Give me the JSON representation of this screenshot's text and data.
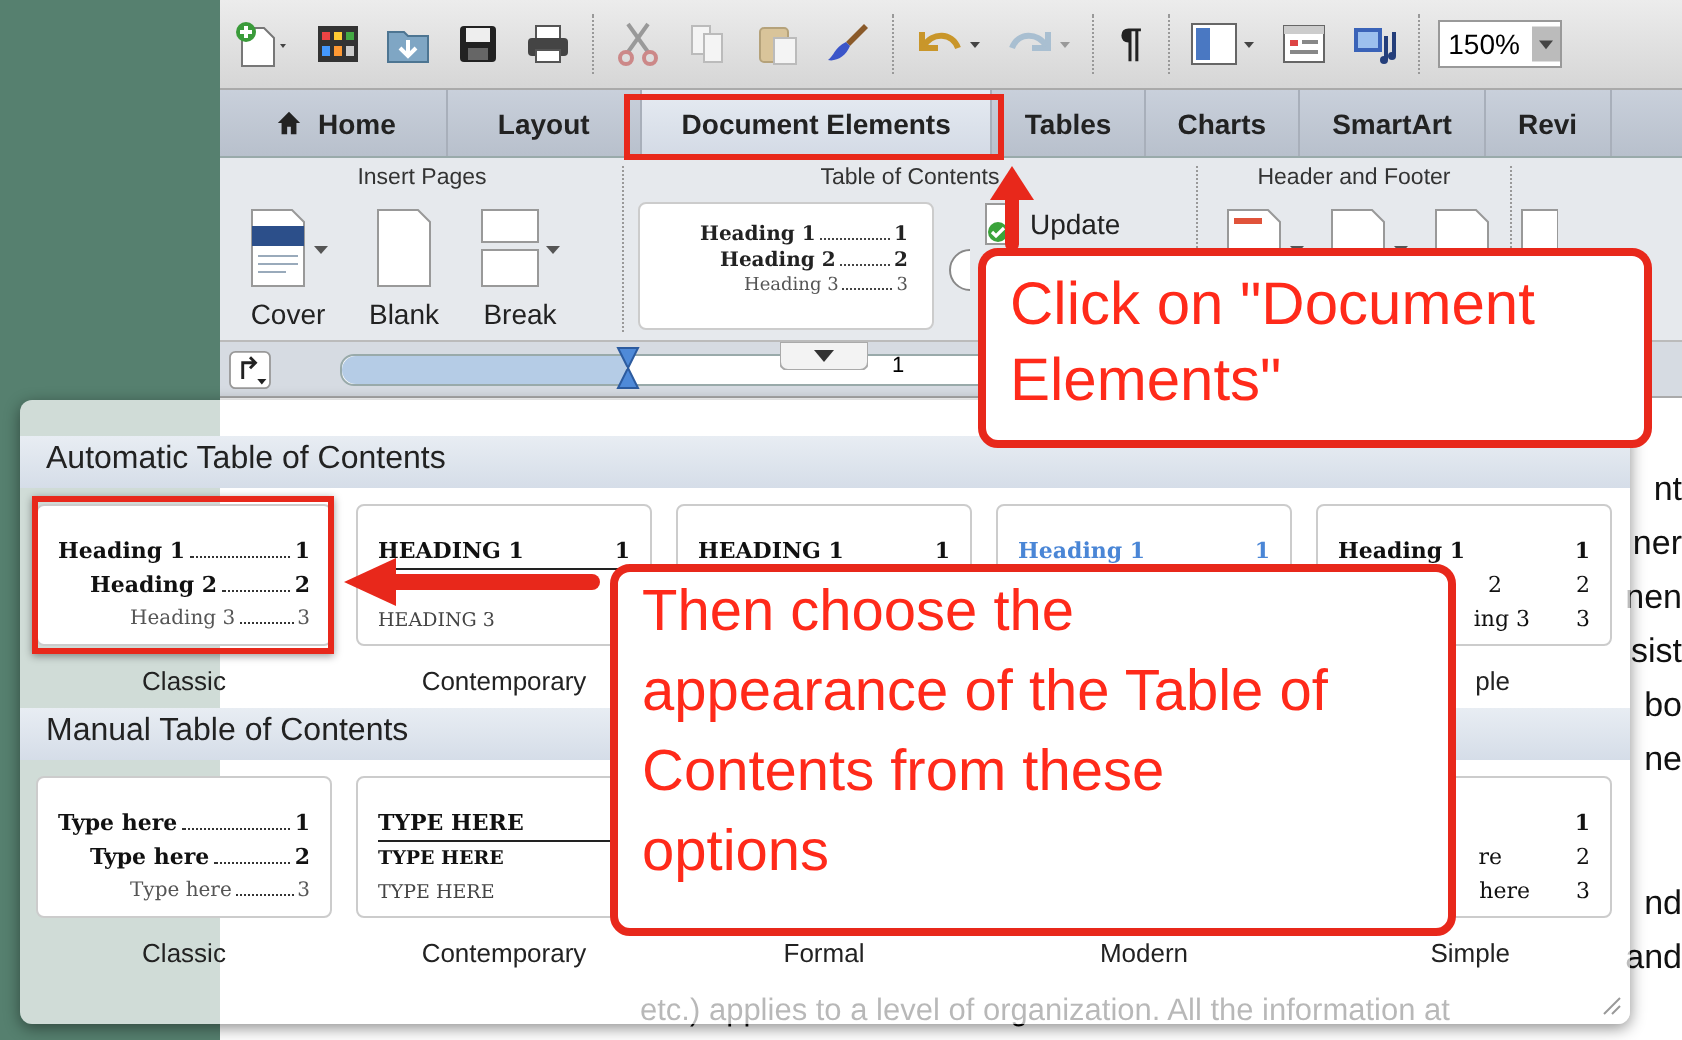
{
  "toolbar": {
    "pilcrow": "¶",
    "zoom": "150%"
  },
  "tabs": [
    {
      "label": "Home",
      "selected": false,
      "kind": "home"
    },
    {
      "label": "Layout",
      "selected": false,
      "kind": "plain"
    },
    {
      "label": "Document Elements",
      "selected": true,
      "kind": "plain"
    },
    {
      "label": "Tables",
      "selected": false,
      "kind": "plain"
    },
    {
      "label": "Charts",
      "selected": false,
      "kind": "plain"
    },
    {
      "label": "SmartArt",
      "selected": false,
      "kind": "plain"
    },
    {
      "label": "Revi",
      "selected": false,
      "kind": "plain"
    }
  ],
  "ribbon": {
    "insert_pages": {
      "title": "Insert Pages",
      "buttons": [
        {
          "label": "Cover",
          "kind": "cover"
        },
        {
          "label": "Blank",
          "kind": "blank"
        },
        {
          "label": "Break",
          "kind": "break"
        }
      ]
    },
    "toc": {
      "title": "Table of Contents",
      "update": "Update",
      "preview": [
        {
          "kind": "h1",
          "text": "Heading 1",
          "num": "1"
        },
        {
          "kind": "h2",
          "text": "Heading 2",
          "num": "2"
        },
        {
          "kind": "h3",
          "text": "Heading 3",
          "num": "3"
        }
      ]
    },
    "header_footer": {
      "title": "Header and Footer"
    }
  },
  "ruler": {
    "mark": "1"
  },
  "gallery": {
    "sections": [
      {
        "title": "Automatic Table of Contents",
        "items": [
          {
            "kind": "classic",
            "label": "Classic",
            "lines": [
              {
                "kind": "h1",
                "text": "Heading 1",
                "num": "1"
              },
              {
                "kind": "h2",
                "text": "Heading 2",
                "num": "2"
              },
              {
                "kind": "h3",
                "text": "Heading 3",
                "num": "3"
              }
            ]
          },
          {
            "kind": "contemporary",
            "label": "Contemporary",
            "lines": [
              {
                "kind": "h1",
                "text": "HEADING 1",
                "num": "1"
              },
              {
                "kind": "h3",
                "text": "HEADING 3"
              }
            ]
          },
          {
            "kind": "formal",
            "lines": [
              {
                "kind": "h1",
                "text": "HEADING 1",
                "num": "1"
              }
            ]
          },
          {
            "kind": "modern",
            "lines": [
              {
                "kind": "h1",
                "text": "Heading 1",
                "num": "1"
              }
            ]
          },
          {
            "kind": "simple",
            "label": "ple",
            "lines": [
              {
                "kind": "h1",
                "text": "Heading 1",
                "num": "1"
              },
              {
                "kind": "h2",
                "text": "2",
                "num": "2"
              },
              {
                "kind": "h3",
                "text": "ing 3",
                "num": "3"
              }
            ]
          }
        ]
      },
      {
        "title": "Manual Table of Contents",
        "items": [
          {
            "kind": "classic",
            "label": "Classic",
            "lines": [
              {
                "kind": "h1",
                "text": "Type here",
                "num": "1"
              },
              {
                "kind": "h2",
                "text": "Type here",
                "num": "2"
              },
              {
                "kind": "h3",
                "text": "Type here",
                "num": "3"
              }
            ]
          },
          {
            "kind": "contemporary",
            "label": "Contemporary",
            "lines": [
              {
                "kind": "h1",
                "text": "TYPE HERE"
              },
              {
                "kind": "h2",
                "text": "TYPE HERE"
              },
              {
                "kind": "h3",
                "text": "TYPE HERE"
              }
            ]
          },
          {
            "kind": "formal",
            "label": "Formal"
          },
          {
            "kind": "modern",
            "label": "Modern"
          },
          {
            "kind": "simple",
            "label": "Simple",
            "lines": [
              {
                "kind": "h1",
                "num": "1"
              },
              {
                "kind": "h2",
                "text": "re",
                "num": "2"
              },
              {
                "kind": "h3",
                "text": "here",
                "num": "3"
              }
            ]
          }
        ]
      }
    ]
  },
  "document": {
    "paragraphs": [
      {
        "lines": [
          {
            "kind": "tail",
            "text": "nt"
          },
          {
            "kind": "tail",
            "text": "ner"
          },
          {
            "kind": "tail",
            "text": "nen"
          },
          {
            "kind": "tail",
            "text": "sist"
          },
          {
            "kind": "tail",
            "text": "bo"
          },
          {
            "kind": "tail",
            "text": "ne"
          }
        ]
      },
      {
        "lines": [
          {
            "kind": "tail",
            "text": "nd"
          },
          {
            "kind": "tail",
            "text": "and"
          },
          {
            "kind": "full",
            "text": "etc.) applies to a level of organization. All the information at"
          }
        ]
      }
    ]
  },
  "callouts": [
    {
      "text": "Click on \"Document Elements\""
    },
    {
      "text": "Then choose the appearance of the Table of Contents from these options"
    }
  ]
}
